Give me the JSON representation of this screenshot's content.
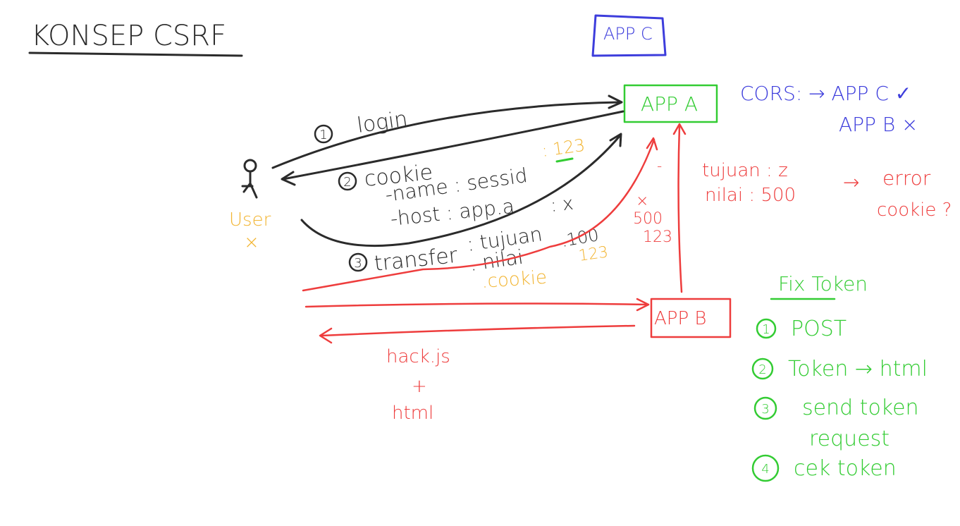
{
  "title": "KONSEP CSRF",
  "app_c": {
    "label": "APP C"
  },
  "app_a": {
    "label": "APP A"
  },
  "app_b": {
    "label": "APP B"
  },
  "cors": {
    "line1": "CORS: → APP C ✓",
    "line2": "APP B ×"
  },
  "user": {
    "label": "User",
    "mark": "×"
  },
  "login": {
    "num": "1",
    "text": "login"
  },
  "cookie": {
    "num": "2",
    "title": "cookie",
    "value": ": 123",
    "name_line": "-name : sessid",
    "host_line": "-host : app.a",
    "tujuan_x": ": x"
  },
  "transfer": {
    "num": "3",
    "text": "transfer",
    "tujuan": ": tujuan",
    "nilai": ". nilai",
    "nilai_value": ".100",
    "cookie_line": ".cookie",
    "cookie_value": "123"
  },
  "attack_values": {
    "x": "×",
    "v500": "500",
    "v123": "123",
    "dash": "-"
  },
  "error_note": {
    "tujuan": "tujuan : z",
    "nilai": "nilai : 500",
    "arrow": "→",
    "error": "error",
    "cookie_q": "cookie ?"
  },
  "hack": {
    "line1": "hack.js",
    "plus": "+",
    "line2": "html"
  },
  "fix": {
    "title": "Fix Token",
    "items": [
      {
        "num": "1",
        "text": "POST"
      },
      {
        "num": "2",
        "text": "Token → html"
      },
      {
        "num": "3",
        "text": "send token"
      },
      {
        "num": "",
        "text": "request"
      },
      {
        "num": "4",
        "text": "cek token"
      }
    ]
  },
  "colors": {
    "ink": "#2b2b2b",
    "blue": "#3d3ddc",
    "green": "#33cc33",
    "red": "#ee3d3d",
    "yellow": "#f2b533"
  }
}
